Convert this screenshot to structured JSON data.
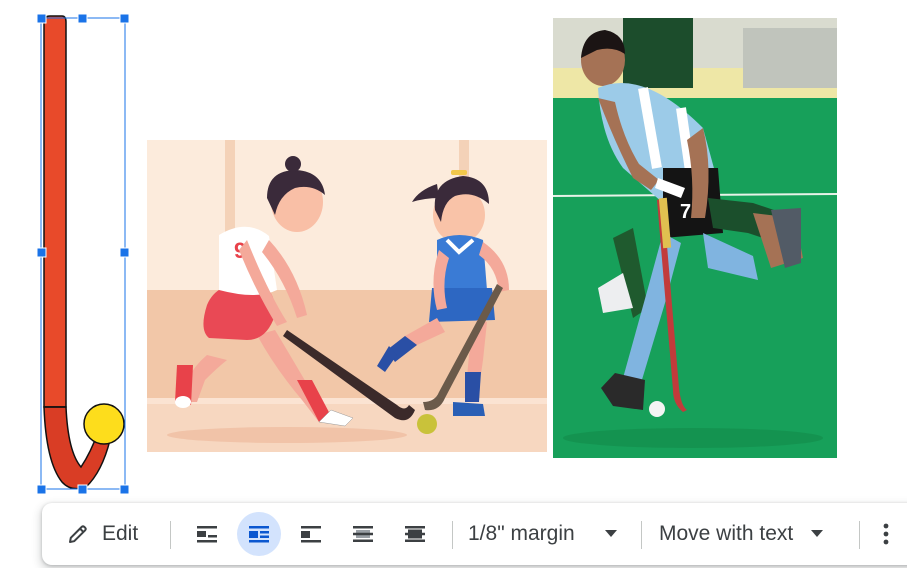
{
  "toolbar": {
    "edit_label": "Edit",
    "margin_label": "1/8\" margin",
    "position_label": "Move with text",
    "wrap_options": [
      {
        "name": "in-line",
        "active": false
      },
      {
        "name": "wrap-text",
        "active": true
      },
      {
        "name": "break-text",
        "active": false
      },
      {
        "name": "behind-text",
        "active": false
      },
      {
        "name": "in-front-of-text",
        "active": false
      }
    ]
  },
  "images": {
    "illustration_jersey_number": "9",
    "photo_jersey_number": "7"
  },
  "colors": {
    "stick_red": "#e84a2a",
    "stick_ball": "#fddd1c",
    "selection_blue": "#1a73e8",
    "active_wrap_bg": "#d3e3fd",
    "field_green": "#159a53"
  }
}
